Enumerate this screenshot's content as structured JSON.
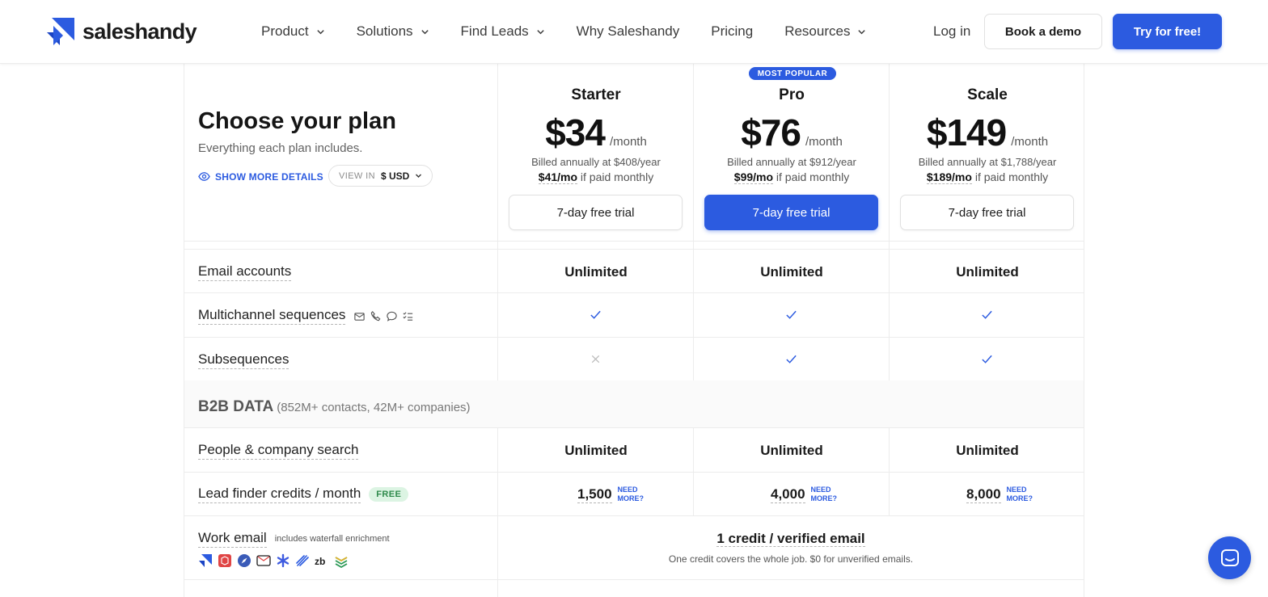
{
  "header": {
    "brand": "saleshandy",
    "nav": [
      {
        "label": "Product",
        "dropdown": true
      },
      {
        "label": "Solutions",
        "dropdown": true
      },
      {
        "label": "Find Leads",
        "dropdown": true
      },
      {
        "label": "Why Saleshandy",
        "dropdown": false
      },
      {
        "label": "Pricing",
        "dropdown": false
      },
      {
        "label": "Resources",
        "dropdown": true
      }
    ],
    "login": "Log in",
    "demo": "Book a demo",
    "try": "Try for free!"
  },
  "intro": {
    "title": "Choose your plan",
    "subtitle": "Everything each plan includes.",
    "show_more": "SHOW MORE DETAILS",
    "view_in": "VIEW IN",
    "currency": "$ USD"
  },
  "plans": [
    {
      "name": "Starter",
      "price": "$34",
      "per": "/month",
      "annual": "Billed annually at $408/year",
      "monthly_price": "$41/mo",
      "monthly_suffix": " if paid monthly",
      "cta": "7-day free trial",
      "badge": ""
    },
    {
      "name": "Pro",
      "price": "$76",
      "per": "/month",
      "annual": "Billed annually at $912/year",
      "monthly_price": "$99/mo",
      "monthly_suffix": " if paid monthly",
      "cta": "7-day free trial",
      "badge": "MOST POPULAR"
    },
    {
      "name": "Scale",
      "price": "$149",
      "per": "/month",
      "annual": "Billed annually at $1,788/year",
      "monthly_price": "$189/mo",
      "monthly_suffix": " if paid monthly",
      "cta": "7-day free trial",
      "badge": ""
    }
  ],
  "features": {
    "email_accounts": {
      "label": "Email accounts",
      "values": [
        "Unlimited",
        "Unlimited",
        "Unlimited"
      ]
    },
    "multichannel": {
      "label": "Multichannel sequences",
      "values": [
        true,
        true,
        true
      ]
    },
    "subsequences": {
      "label": "Subsequences",
      "values": [
        false,
        true,
        true
      ]
    }
  },
  "b2b": {
    "title": "B2B DATA",
    "subtitle": "(852M+ contacts, 42M+ companies)",
    "people_search": {
      "label": "People & company search",
      "values": [
        "Unlimited",
        "Unlimited",
        "Unlimited"
      ]
    },
    "lead_credits": {
      "label": "Lead finder credits / month",
      "badge": "FREE",
      "values": [
        "1,500",
        "4,000",
        "8,000"
      ],
      "need_more": [
        "NEED",
        "MORE?"
      ]
    },
    "work_email": {
      "label": "Work email",
      "note": "includes waterfall enrichment",
      "value": "1 credit / verified email",
      "value_note": "One credit covers the whole job. $0 for unverified emails."
    }
  },
  "colors": {
    "accent": "#2c5be0",
    "free_badge_bg": "#dcf4e3",
    "free_badge_text": "#2e8a4b"
  }
}
